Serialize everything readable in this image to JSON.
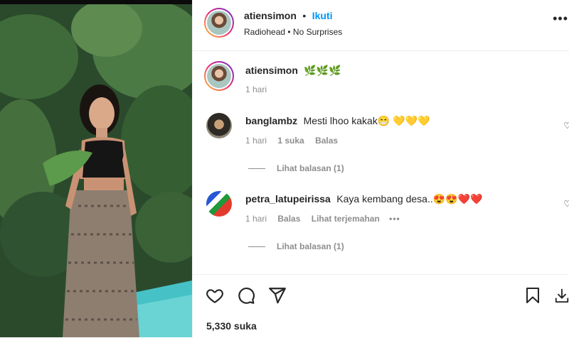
{
  "post": {
    "username": "atiensimon",
    "follow_label": "Ikuti",
    "separator": "•",
    "audio": "Radiohead • No Surprises",
    "caption_emoji": "🌿🌿🌿",
    "caption_time": "1 hari",
    "likes": "5,330 suka"
  },
  "comments": [
    {
      "username": "banglambz",
      "text": "Mesti lhoo kakak😁 💛💛💛",
      "time": "1 hari",
      "likes": "1 suka",
      "reply": "Balas",
      "view_replies": "Lihat balasan (1)"
    },
    {
      "username": "petra_latupeirissa",
      "text": "Kaya kembang desa..😍😍❤️❤️",
      "time": "1 hari",
      "reply": "Balas",
      "translate": "Lihat terjemahan",
      "options": "•••",
      "view_replies": "Lihat balasan (1)"
    }
  ],
  "icons": [
    "heart-icon",
    "comment-icon",
    "share-icon",
    "bookmark-icon",
    "more-options-icon"
  ],
  "colors": {
    "accent": "#0095f6",
    "text": "#262626",
    "muted": "#8e8e8e",
    "border": "#efefef"
  }
}
